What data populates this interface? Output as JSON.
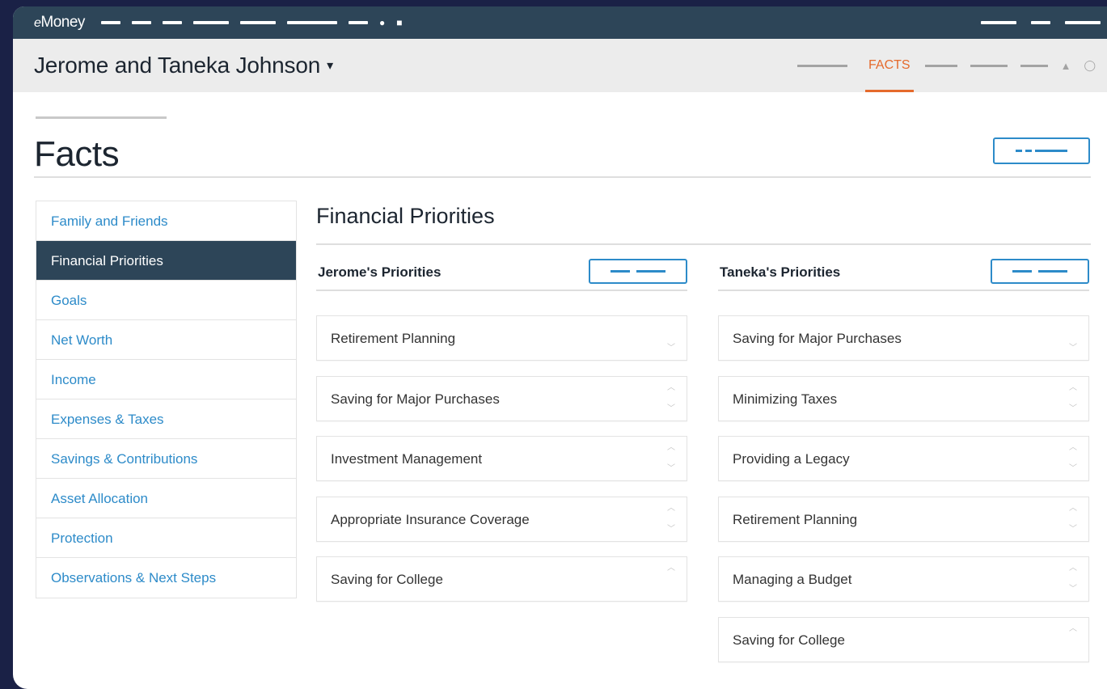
{
  "app": {
    "brand": "Money",
    "brand_prefix": "e"
  },
  "client": {
    "name": "Jerome and Taneka Johnson",
    "caret": "▾"
  },
  "subnav": {
    "active_tab": "FACTS"
  },
  "page": {
    "title": "Facts"
  },
  "sidebar": {
    "items": [
      {
        "label": "Family and Friends",
        "active": false
      },
      {
        "label": "Financial Priorities",
        "active": true
      },
      {
        "label": "Goals",
        "active": false
      },
      {
        "label": "Net Worth",
        "active": false
      },
      {
        "label": "Income",
        "active": false
      },
      {
        "label": "Expenses & Taxes",
        "active": false
      },
      {
        "label": "Savings & Contributions",
        "active": false
      },
      {
        "label": "Asset Allocation",
        "active": false
      },
      {
        "label": "Protection",
        "active": false
      },
      {
        "label": "Observations & Next Steps",
        "active": false
      }
    ]
  },
  "section": {
    "title": "Financial Priorities"
  },
  "jerome": {
    "title": "Jerome's Priorities",
    "items": [
      {
        "label": "Retirement Planning",
        "up": false,
        "down": true
      },
      {
        "label": "Saving for Major Purchases",
        "up": true,
        "down": true
      },
      {
        "label": "Investment Management",
        "up": true,
        "down": true
      },
      {
        "label": "Appropriate Insurance Coverage",
        "up": true,
        "down": true
      },
      {
        "label": "Saving for College",
        "up": true,
        "down": false
      }
    ]
  },
  "taneka": {
    "title": "Taneka's Priorities",
    "items": [
      {
        "label": "Saving for Major Purchases",
        "up": false,
        "down": true
      },
      {
        "label": "Minimizing Taxes",
        "up": true,
        "down": true
      },
      {
        "label": "Providing a Legacy",
        "up": true,
        "down": true
      },
      {
        "label": "Retirement Planning",
        "up": true,
        "down": true
      },
      {
        "label": "Managing a Budget",
        "up": true,
        "down": true
      },
      {
        "label": "Saving for College",
        "up": true,
        "down": false
      }
    ]
  },
  "icons": {
    "up": "︿",
    "down": "﹀",
    "topbar": [
      "bell-icon",
      "settings-icon"
    ],
    "subnav": [
      "person-icon",
      "globe-icon"
    ]
  },
  "colors": {
    "nav": "#2d4558",
    "accent": "#e56a2c",
    "link": "#2d8bc9",
    "background": "#1a2146"
  }
}
